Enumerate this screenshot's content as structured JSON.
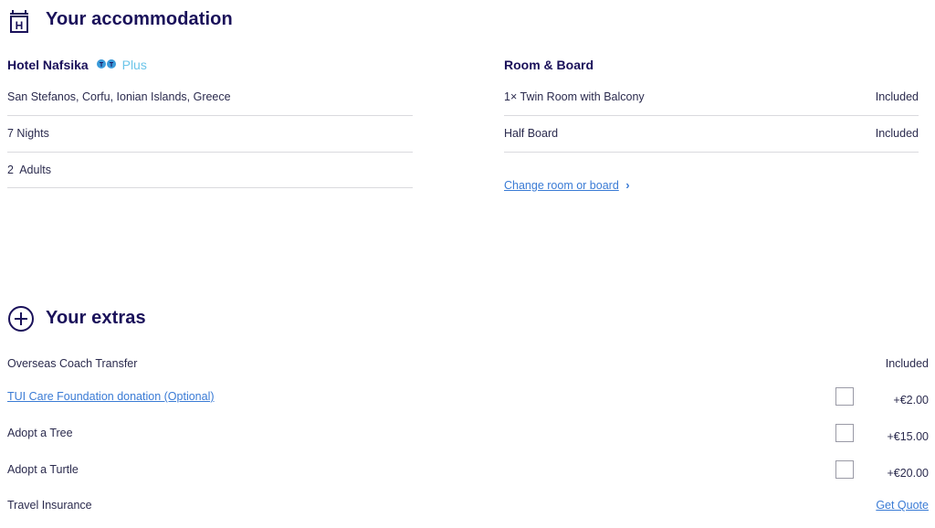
{
  "accommodation": {
    "heading": "Your accommodation",
    "hotel_name": "Hotel Nafsika",
    "hotel_badge": "Plus",
    "details": [
      "San Stefanos, Corfu, Ionian Islands, Greece",
      "7 Nights",
      "2  Adults"
    ],
    "room_board_heading": "Room & Board",
    "room_items": [
      {
        "label": "1× Twin Room with Balcony",
        "value": "Included"
      },
      {
        "label": "Half Board",
        "value": "Included"
      }
    ],
    "change_link": "Change room or board",
    "change_chevron": "›"
  },
  "extras": {
    "heading": "Your extras",
    "items": [
      {
        "label": "Overseas Coach Transfer",
        "value": "Included"
      },
      {
        "label": "TUI Care Foundation donation (Optional)",
        "value": "+€2.00"
      },
      {
        "label": "Adopt a Tree",
        "value": "+€15.00"
      },
      {
        "label": "Adopt a Turtle",
        "value": "+€20.00"
      },
      {
        "label": "Travel Insurance",
        "value": "Get Quote"
      }
    ]
  },
  "icons": {
    "hotel": "hotel-sign-icon",
    "extras": "plus-circle-icon",
    "rating": "tui-rating-icon"
  },
  "colors": {
    "heading": "#1a115a",
    "link": "#3a7bd5",
    "plus_badge": "#6cc5e9",
    "divider": "#dadade"
  }
}
